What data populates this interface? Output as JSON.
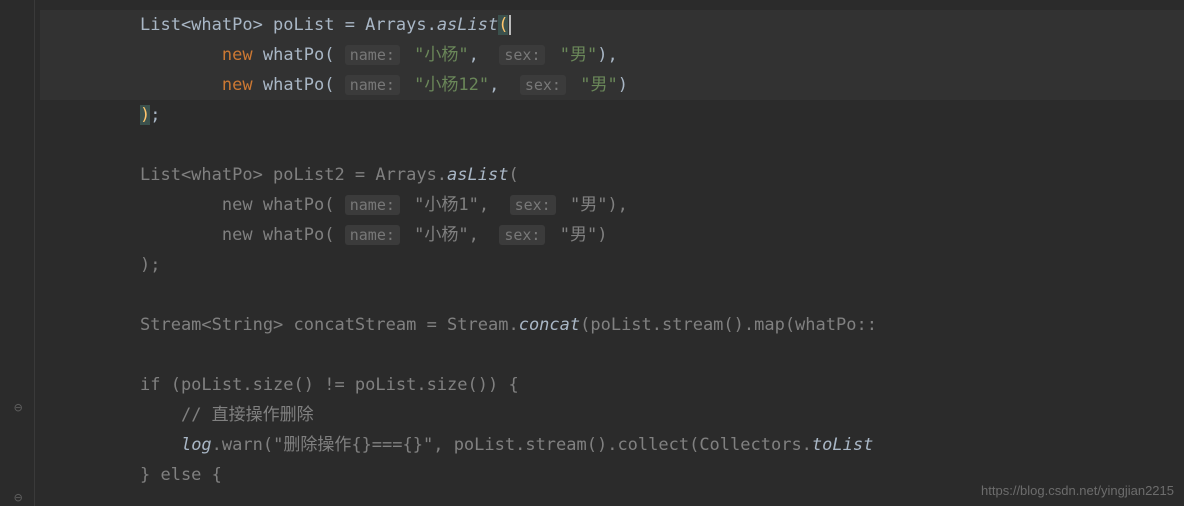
{
  "lines": {
    "l1": {
      "pre": "List<whatPo> poList = Arrays.",
      "method": "asList",
      "open": "(",
      "cursor": true
    },
    "l2": {
      "kw": "new",
      "ctor": " whatPo(",
      "h1": "name:",
      "v1": "\"小杨\"",
      "comma1": ",  ",
      "h2": "sex:",
      "v2": "\"男\"",
      "close": "),"
    },
    "l3": {
      "kw": "new",
      "ctor": " whatPo(",
      "h1": "name:",
      "v1": "\"小杨12\"",
      "comma1": ",  ",
      "h2": "sex:",
      "v2": "\"男\"",
      "close": ")"
    },
    "l4": {
      "close": ");"
    },
    "l5": "",
    "l6": {
      "text": "List<whatPo> poList2 = Arrays.",
      "method": "asList",
      "open": "("
    },
    "l7": {
      "pre": "new whatPo(",
      "h1": "name:",
      "v1": "\"小杨1\"",
      "comma1": ",  ",
      "h2": "sex:",
      "v2": "\"男\"",
      "close": "),"
    },
    "l8": {
      "pre": "new whatPo(",
      "h1": "name:",
      "v1": "\"小杨\"",
      "comma1": ",  ",
      "h2": "sex:",
      "v2": "\"男\"",
      "close": ")"
    },
    "l9": {
      "text": ");"
    },
    "l10": "",
    "l11": {
      "p1": "Stream<String> concatStream = Stream.",
      "method": "concat",
      "p2": "(poList.stream().map(whatPo::"
    },
    "l12": "",
    "l13": {
      "text": "if (poList.size() != poList.size()) {"
    },
    "l14": {
      "comment": "// 直接操作删除"
    },
    "l15": {
      "obj": "log",
      "call": ".warn(",
      "str": "\"删除操作{}==={}\"",
      "rest": ", poList.stream().collect(Collectors.",
      "method": "toList"
    },
    "l16": {
      "text": "} else {"
    }
  },
  "watermark": "https://blog.csdn.net/yingjian2215"
}
